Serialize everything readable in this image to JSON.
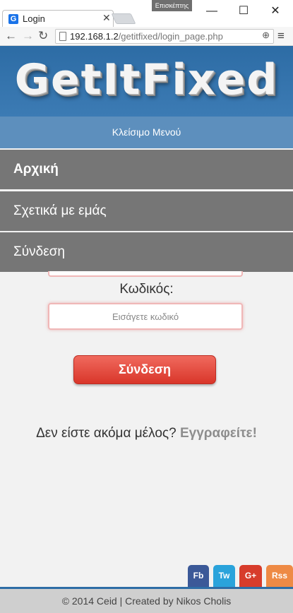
{
  "browser": {
    "guest_badge": "Επισκέπτης",
    "tab_title": "Login",
    "tab_favicon": "G",
    "url_host": "192.168.1.2",
    "url_path": "/getitfixed/login_page.php"
  },
  "site": {
    "logo": "GetItFixed",
    "menu_toggle": "Κλείσιμο Μενού",
    "nav": [
      {
        "label": "Αρχική"
      },
      {
        "label": "Σχετικά με εμάς"
      },
      {
        "label": "Σύνδεση"
      }
    ]
  },
  "form": {
    "password_label": "Κωδικός:",
    "password_placeholder": "Εισάγετε κωδικό",
    "submit_label": "Σύνδεση",
    "register_prompt": "Δεν είστε ακόμα μέλος?",
    "register_link": "Εγγραφείτε!"
  },
  "social": {
    "fb": "Fb",
    "tw": "Tw",
    "gplus": "G+",
    "rss": "Rss"
  },
  "footer": {
    "text": "© 2014 Ceid | Created by Nikos Cholis"
  },
  "colors": {
    "header": "#2d6ca5",
    "menu_toggle": "#5d8fbd",
    "nav_item": "#767676",
    "submit": "#e5483c",
    "footer": "#cfcfcf"
  }
}
